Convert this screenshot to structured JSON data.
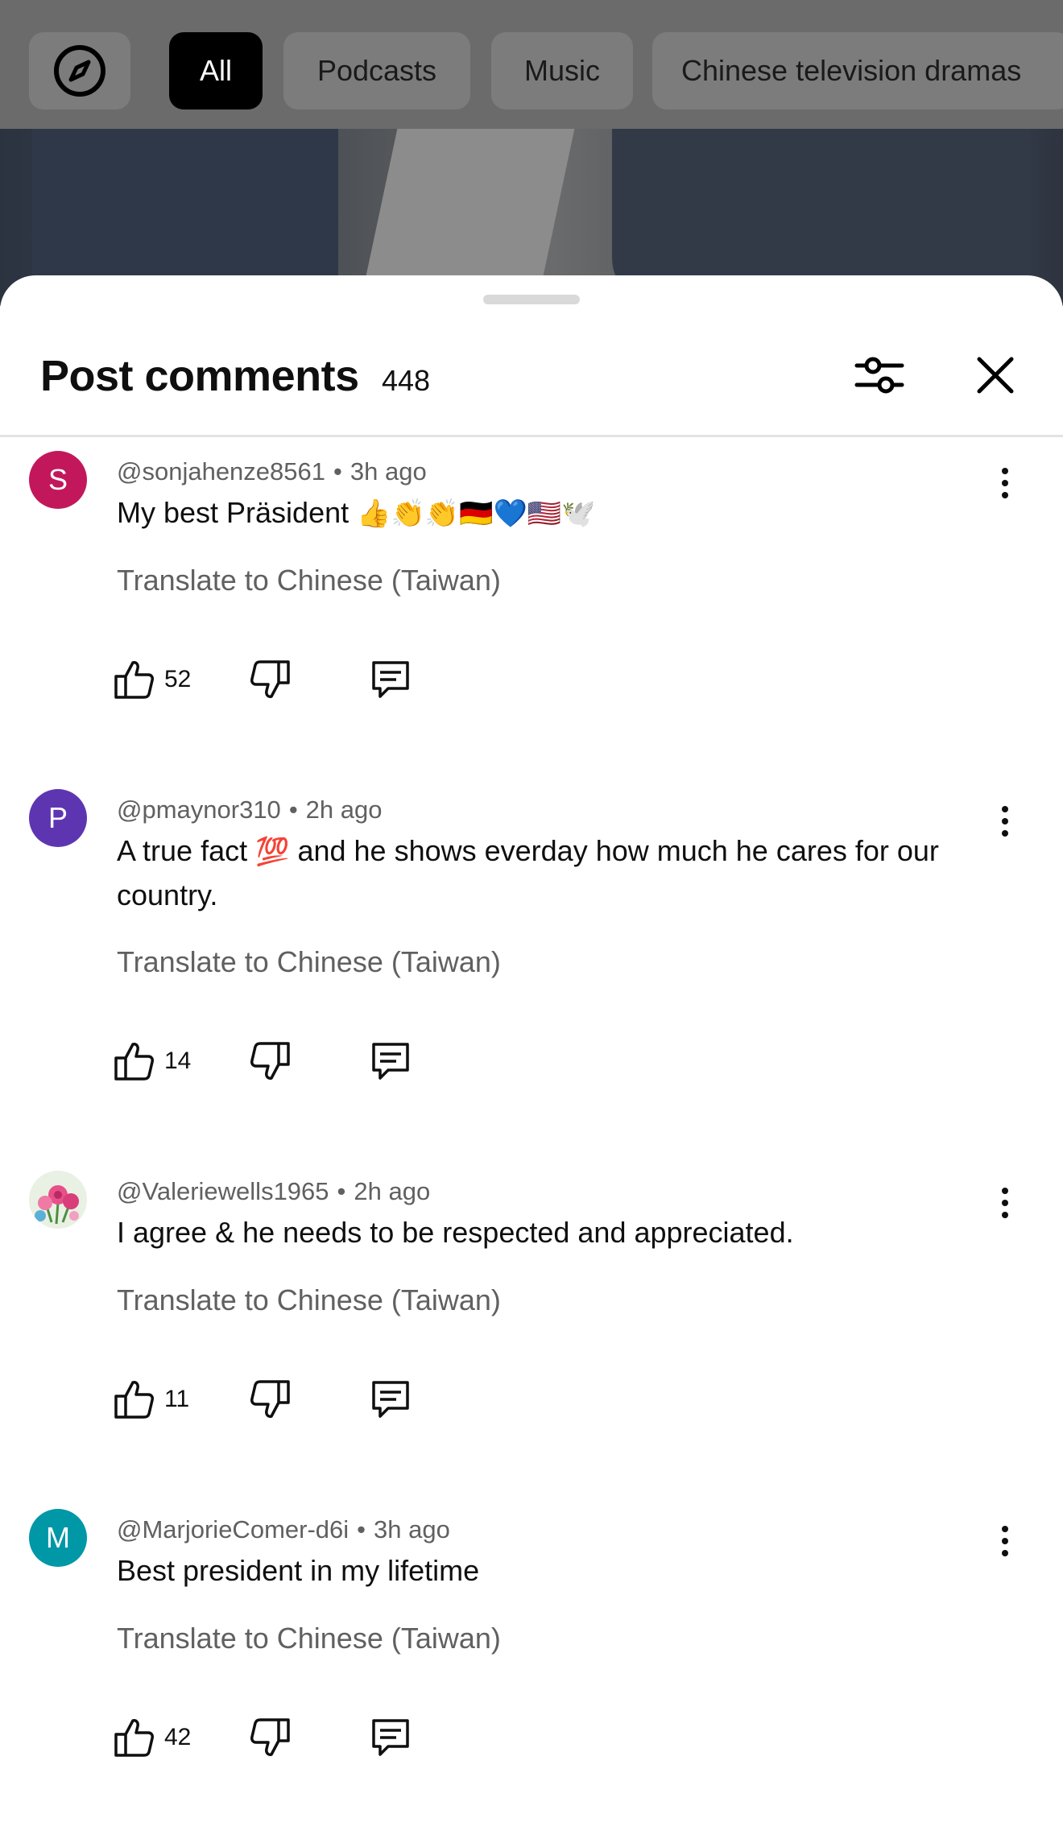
{
  "chips": {
    "explore_icon": "compass-icon",
    "items": [
      {
        "label": "All",
        "active": true
      },
      {
        "label": "Podcasts",
        "active": false
      },
      {
        "label": "Music",
        "active": false
      },
      {
        "label": "Chinese television dramas",
        "active": false
      }
    ]
  },
  "sheet": {
    "title": "Post comments",
    "count": "448",
    "filter_icon": "sliders-icon",
    "close_icon": "close-icon"
  },
  "translate_label": "Translate to Chinese (Taiwan)",
  "comments": [
    {
      "avatar_letter": "S",
      "avatar_color": "#c2185b",
      "handle": "@sonjahenze8561",
      "time": "3h ago",
      "text": "My best Präsident",
      "emoji": "👍👏👏🇩🇪💙🇺🇸🕊️",
      "likes": "52"
    },
    {
      "avatar_letter": "P",
      "avatar_color": "#5e35b1",
      "handle": "@pmaynor310",
      "time": "2h ago",
      "text_before": "A true fact",
      "emoji": "💯",
      "text_after": "and he shows everday how much he cares for our country.",
      "likes": "14"
    },
    {
      "avatar_image": "flowers",
      "handle": "@Valeriewells1965",
      "time": "2h ago",
      "text": "I agree & he needs to be respected and appreciated.",
      "likes": "11"
    },
    {
      "avatar_letter": "M",
      "avatar_color": "#0097a7",
      "handle": "@MarjorieComer-d6i",
      "time": "3h ago",
      "text": "Best president in my lifetime",
      "likes": "42"
    }
  ]
}
